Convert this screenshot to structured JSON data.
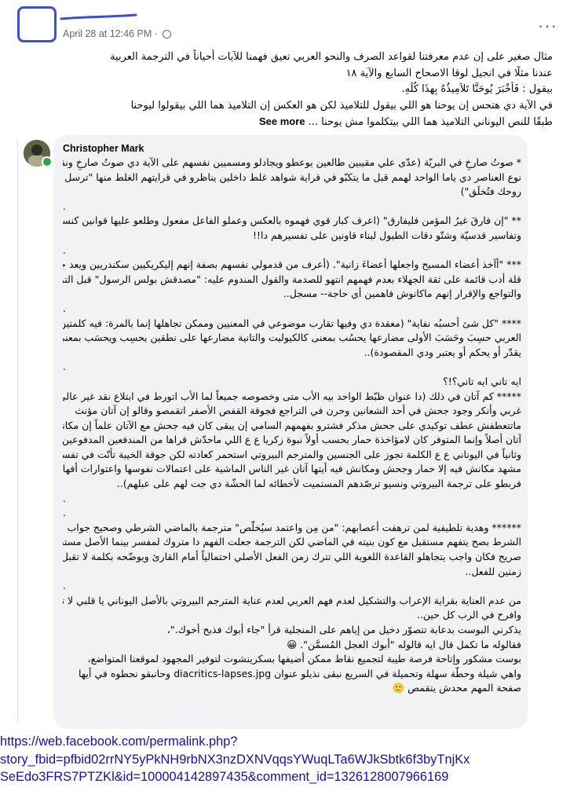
{
  "post": {
    "timestamp": "April 28 at 12:46 PM",
    "separator": "·",
    "more_label": "···",
    "lines": [
      "مثال صغير على إن عدم معرفتنا لقواعد الصرف والنحو العربي تعيق فهمنا للآيات أحياناً في الترجمة العربية",
      "عندنا مثلًا في انجيل لوقا الاصحاح السابع والآية ١٨",
      "بيقول : فَأَخْبَرَ يُوحَنَّا تَلاَمِيذُهُ بِهذَا كُلِّهِ.",
      "في الآية دي هتحس إن  يوحنا هو اللي بيقول للتلاميذ لكن هو العكس إن التلاميذ هما اللي بيقولوا ليوحنا",
      "طبقًا للنص اليوناني التلاميذ هما اللي بيتكلموا مش يوحنا ..."
    ],
    "see_more": "See more"
  },
  "comment": {
    "author": "Christopher Mark",
    "lines": [
      "* صوتُ صارخٍ في البريّة (عدّى علي مقيبين طالعين يوعطو ويجادلو ومسميين نفسهم على الآية دي صوتُ صارخٍ ونفس",
      "نوع العناصر دي ياما الواحد لهمم قبل ما يتكبّو في قراية شواهد غلط داخلين يناظرو في قرايتهم الغلط منها \"ترسل",
      "روحك فتُخلَق\")",
      "",
      "** \"إن فارقَ غيرُ المؤمن فليفارق\" (اعرف كبار قوي فهموه بالعكس وعملو الفاعل مفعول وطلعو عليها قوانين كنسيّة",
      "وتفاسير قدسيّة وشتّو دقات الطبول لبناء قاونين على تفسيرهم دا!!",
      "",
      "*** \"أآخذ أعضاء المسيح واجعلها أعضاءَ زانية\". (أعرف من قدمولي نفسهم بصفة إنهم إليكريكيين سكندريين ويعد جولة",
      "قلة أدب قائمة على ثقة الجهلاء بعدم فهمهم انتهو للصدمة والقول المندوم عليه: \"مصدقش بولس الرسول\" قبل التراجع",
      "والتواجع والإقرار إنهم ماكانوش فاهمين أي حاجة-- مسجل..",
      "",
      "**** \"كل شئ أحسبُه نفاية\" (معقدة دي وفيها تقارب موضوعي في المعنيين وممكن تجاهلها إنما بالمرة: فيه كلمتين في",
      "العربي حسِبَ وحَسَبَ الأولى مضارعها يحسُب بمعنى كالكيوليت والتانية مضارعها على نطقين يحسِب ويحسَب بمعنى",
      "يقدّر أو يحكم أو يعتبر ودي المقصودة)..",
      "",
      "ايه تاني ايه تاني؟!؟",
      "***** كم آتان في ذلك (دا عنوان ظبّط الواحد بيه الأب متى وخصوصه جميعاً لما الأب اتورط في ابتلاع نقد غير عالي",
      "غربي وأنكر وجود جحش في أحد الشعانين وحرن في التراجع فجوقة القفص الأصفر اتقمصو وقالو إن آتان مؤنث",
      "ماتتعطفش عطف توكيدي على جحش مذكر فشترو بفهمهم السامي إن يبقى كان فيه جحش مع الآتان علماً إن مكانش فيه",
      "آتان أصلاً وإنما المتوفر كان لامؤاخذة حمار بحسب أولاً نبوة زكريا ع ع اللي ماحدّش قراها من المندفعين المدفوعين",
      "وثانياً في اليوناني ع ع الكلمة تجوز على الجنسين والمترجم البيروتي استحمر كعادته لكن جوقة الخيبة تأتّت في تفسير",
      "مشهد مكانش فيه إلا حمار وجحش ومكانش فيه أيتها آتان غير الناس الماشية على اعتمالات نفوسها واعتوارات أفهامها",
      "فربطو على ترجمة البيروتي ونسيو ترصّدهم المستميت لأخطائه لما الحشّة دي جت لهم على عبلهم)..",
      "",
      "",
      "****** وهدية تلطيفية لمن ترهفت أعصابهم: \"من مِن واعتمد سيُخلّص\" مترجمة بالماضي الشرطي وصحيح جواب",
      "الشرط بصح يتفهم مستقبل مع كون بنيته في الماضي لكن الترجمة جعلت الفهم دا متروك لمفسر بينما الأصل مستقبل",
      "صريح فكان واجب يتجاهلو القاعدة اللغوية اللي تترك زمن الفعل الأصلي احتمالياً أمام القارئ ويوضّحه بكلمة لا تقبل",
      "زمنين للفعل..",
      "",
      "من عدم العناية بقراية الإعراب والتشكيل لعدم فهم العربي لعدم عناية المترجم البيروتي بالأصل اليوناني يا قلبي لا تحزن",
      "وافرح في الرب كل حين..",
      "يذكرني البوست بدعابة تتصوّر دخيل من إياهم على المنجلية قرأ \"جاء أبوك فذبح أخوك.\"،",
      "فقالوله ما تكمل قال ايه قالوله \"أبوك العجل المُسمَّن\". 😀",
      "بوست مشكور وإتاحة فرصة طيبة لتجميع نقاط ممكن أضيفها بسكرينشوت لتوفير المجهود لموقعنا المتواضع،",
      "واهي شيلة وحطّة سهلة وتحميلة في السريع نبقى نذيلو عنوان diacritics-lapses.jpg وحانبقو نحطوه في أيها",
      "صفحة المهم محدش يتقمص 🙂"
    ],
    "gap_marks": [
      "."
    ]
  },
  "url": {
    "lines": [
      "https://web.facebook.com/permalink.php?",
      "story_fbid=pfbid02rrNY5yPkNH9rbNX3nzDXNVqqsYWuqLTa6WJkSbtk6f3byTnjKx",
      "SeEdo3FRS7PTZKl&id=100004142897435&comment_id=1326128007966169"
    ]
  }
}
